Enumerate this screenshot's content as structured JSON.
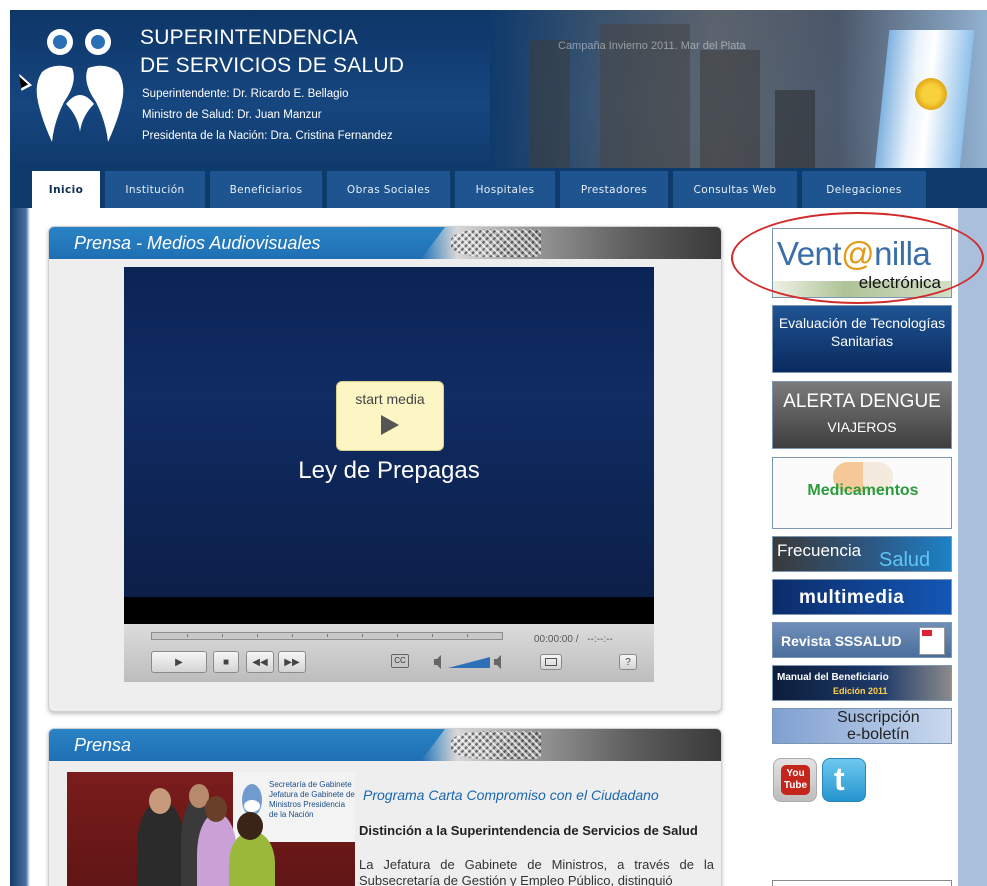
{
  "header": {
    "title_line1": "SUPERINTENDENCIA",
    "title_line2": "DE SERVICIOS DE SALUD",
    "line1": "Superintendente: Dr. Ricardo E. Bellagio",
    "line2": "Ministro de Salud: Dr. Juan Manzur",
    "line3": "Presidenta de la Nación: Dra. Cristina Fernandez",
    "photo_caption": "Campaña Invierno 2011. Mar del Plata"
  },
  "nav": {
    "active": "Inicio",
    "tabs": [
      "Inicio",
      "Institución",
      "Beneficiarios",
      "Obras Sociales",
      "Hospitales",
      "Prestadores",
      "Consultas Web",
      "Delegaciones"
    ]
  },
  "media_panel": {
    "title": "Prensa - Medios Audiovisuales",
    "start_label": "start media",
    "media_title": "Ley de Prepagas",
    "time_current": "00:00:00 /",
    "time_total": "--:--:--",
    "cc_label": "CC",
    "help_label": "?"
  },
  "news_panel": {
    "title": "Prensa",
    "photo_banner": "Secretaría de Gabinete Jefatura de Gabinete de Ministros Presidencia de la Nación",
    "headline": "Programa Carta Compromiso con el Ciudadano",
    "subheadline": "Distinción a la Superintendencia de Servicios de Salud",
    "body": "La Jefatura de Gabinete de Ministros, a través de la Subsecretaría de Gestión y Empleo Público, distinguió"
  },
  "sidebar": {
    "ventanilla_main": "Vent",
    "ventanilla_at": "@",
    "ventanilla_rest": "nilla",
    "ventanilla_sub": "electrónica",
    "evaluacion": "Evaluación de Tecnologías Sanitarias",
    "dengue_1": "ALERTA DENGUE",
    "dengue_2": "VIAJEROS",
    "medicamentos": "Medicamentos",
    "frecuencia_a": "Frecuencia",
    "frecuencia_b": "Salud",
    "multimedia": "multimedia",
    "revista": "Revista SSSALUD",
    "manual_1": "Manual del Beneficiario",
    "manual_2": "Edición 2011",
    "suscripcion_1": "Suscripción",
    "suscripcion_2": "e-boletín"
  },
  "social": {
    "youtube": "You Tube",
    "twitter": "t"
  },
  "colors": {
    "header_blue": "#0e3668",
    "nav_tab": "#1e548f",
    "panel_head": "#2a83c6",
    "highlight_oval": "#d22a2a"
  }
}
